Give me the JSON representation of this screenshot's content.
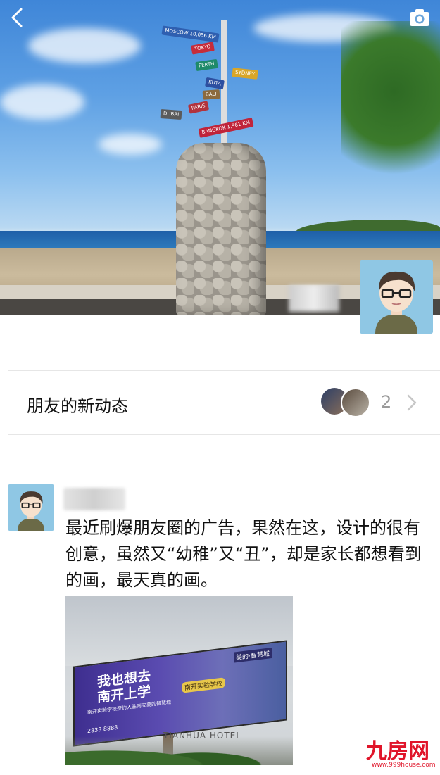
{
  "cover": {
    "back_icon": "chevron-left-icon",
    "camera_icon": "camera-icon",
    "signs": [
      "MOSCOW 10,056 KM",
      "TOKYO",
      "PERTH",
      "SYDNEY",
      "KUTA",
      "BALI",
      "PARIS",
      "DUBAI",
      "BANGKOK 1,961 KM"
    ]
  },
  "new_moments": {
    "label": "朋友的新动态",
    "count": "2",
    "chevron_icon": "chevron-right-icon"
  },
  "post": {
    "text": "最近刷爆朋友圈的广告，果然在这，设计的很有创意，虽然又“幼稚”又“丑”，却是家长都想看到的画，最天真的画。",
    "image": {
      "brand_tag": "美的·智慧城",
      "headline": "我也想去南开上学",
      "subline": "南开实验学校签约人驻南安美的智慧城",
      "phone": "2833 8888",
      "badge": "南开实验学校",
      "hotel_sign": "TIANHUA HOTEL"
    }
  },
  "watermark": {
    "logo": "九房网",
    "url": "www.999house.com"
  },
  "colors": {
    "brand_red": "#e0152a",
    "avatar_bg": "#8fc7e4",
    "divider": "#e6e6e6"
  }
}
